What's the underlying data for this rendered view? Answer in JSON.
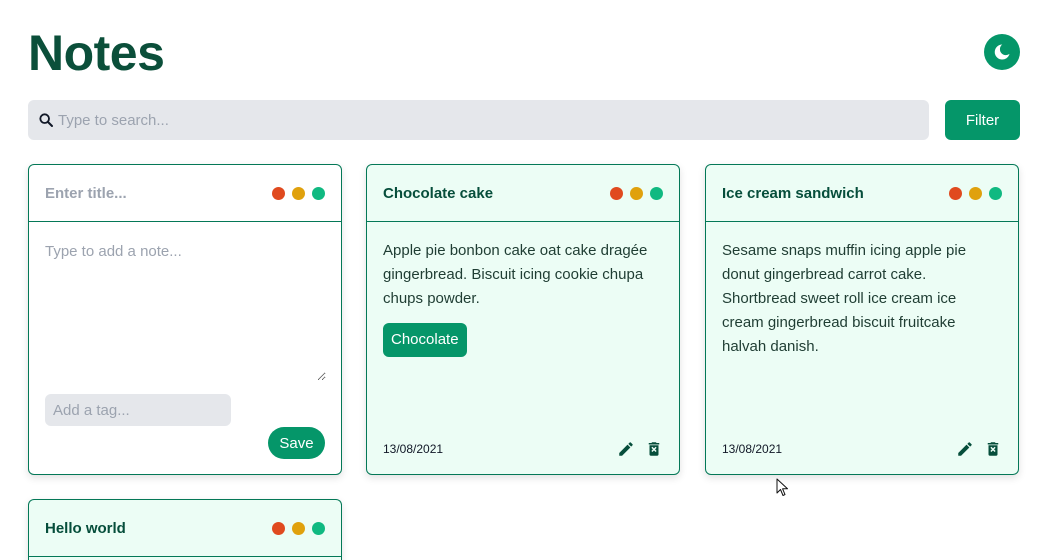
{
  "app": {
    "title": "Notes"
  },
  "search": {
    "placeholder": "Type to search..."
  },
  "filter": {
    "label": "Filter"
  },
  "colors": {
    "accent": "#059669",
    "dot_red": "#e04a1f",
    "dot_yellow": "#e0a10d",
    "dot_green": "#10b981"
  },
  "new_note": {
    "title_placeholder": "Enter title...",
    "body_placeholder": "Type to add a note...",
    "tag_placeholder": "Add a tag...",
    "save_label": "Save"
  },
  "notes": [
    {
      "title": "Chocolate cake",
      "body": "Apple pie bonbon cake oat cake dragée gingerbread. Biscuit icing cookie chupa chups powder.",
      "tag": "Chocolate",
      "date": "13/08/2021"
    },
    {
      "title": "Ice cream sandwich",
      "body": "Sesame snaps muffin icing apple pie donut gingerbread carrot cake. Shortbread sweet roll ice cream ice cream gingerbread biscuit fruitcake halvah danish.",
      "date": "13/08/2021"
    },
    {
      "title": "Hello world"
    }
  ],
  "icons": [
    "moon-icon",
    "search-icon",
    "edit-icon",
    "delete-icon",
    "mouse-cursor-icon"
  ]
}
